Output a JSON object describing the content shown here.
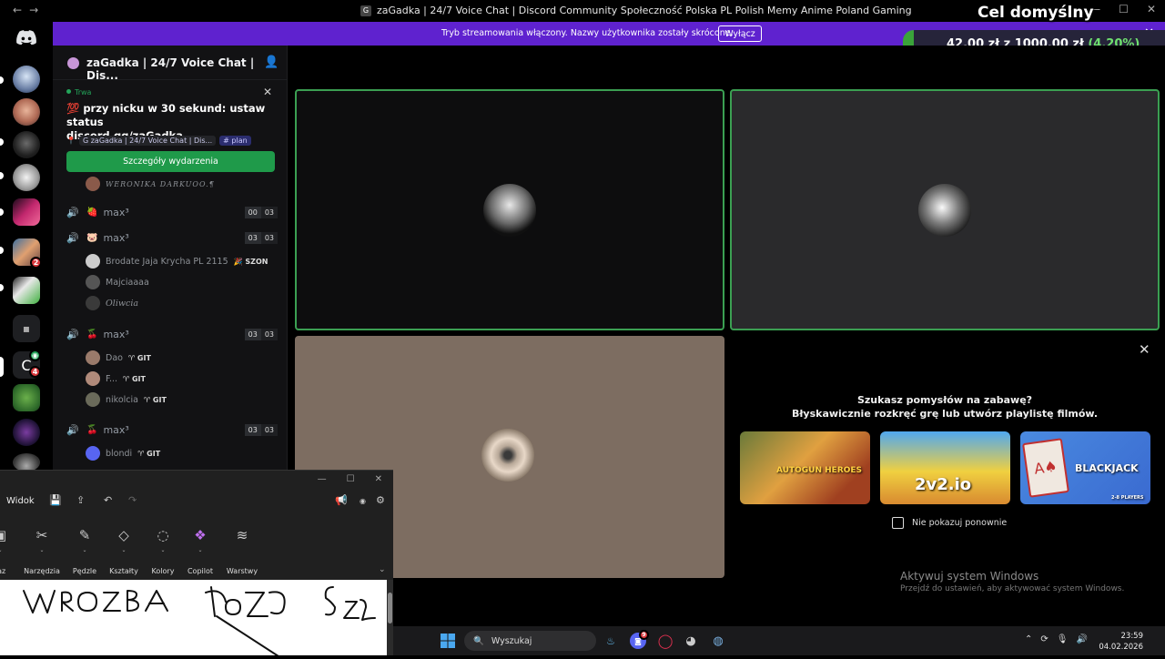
{
  "window": {
    "title": "zaGadka | 24/7 Voice Chat | Discord Community Społeczność Polska PL Polish Memy Anime Poland Gaming",
    "title_icon_letter": "G",
    "back": "←",
    "forward": "→"
  },
  "goal": {
    "heading": "Cel domyślny",
    "current": "42,00 zł",
    "separator": "z",
    "target": "1000,00 zł",
    "percent": "(4.20%)",
    "progress_fraction": 0.042
  },
  "stream_banner": {
    "message": "Tryb streamowania włączony. Nazwy użytkownika zostały skrócone.",
    "button": "Wyłącz",
    "close": "✕"
  },
  "guild_badges": {
    "b1": "2",
    "b2": "4"
  },
  "server": {
    "name": "zaGadka | 24/7 Voice Chat | Dis...",
    "invite_icon": "person-add-icon"
  },
  "event": {
    "status": "Trwa",
    "close": "✕",
    "title_line1": "💯 przy nicku w 30 sekund: ustaw status",
    "title_line2": "discord.gg/zaGadka",
    "location_server": "G zaGadka | 24/7 Voice Chat | Dis...",
    "location_channel": "# plan",
    "details_button": "Szczegóły wydarzenia"
  },
  "channels": [
    {
      "emoji": "🍓",
      "name": "max³",
      "count_a": "00",
      "count_b": "03",
      "active": false
    },
    {
      "emoji": "🐷",
      "name": "max³",
      "count_a": "03",
      "count_b": "03",
      "active": true
    },
    {
      "emoji": "🍒",
      "name": "max³",
      "count_a": "03",
      "count_b": "03",
      "active": true
    },
    {
      "emoji": "🍒",
      "name": "max³",
      "count_a": "03",
      "count_b": "03",
      "active": true
    }
  ],
  "users": {
    "top_partial": "WERONIKA DARKUOO.¶",
    "c2": [
      {
        "name": "Brodate Jaja Krycha PL 2115",
        "tag": "🎉 SZON"
      },
      {
        "name": "Majciaaaa",
        "tag": ""
      },
      {
        "name": "Oliwcia",
        "tag": ""
      }
    ],
    "c3": [
      {
        "name": "Dao",
        "tag": "♈ GIT"
      },
      {
        "name": "F...",
        "tag": "♈ GIT"
      },
      {
        "name": "nikolcia",
        "tag": "♈ GIT"
      }
    ],
    "c4": [
      {
        "name": "blondi",
        "tag": "♈ GIT"
      }
    ]
  },
  "activity": {
    "question": "Szukasz pomysłów na zabawę?",
    "subtitle": "Błyskawicznie rozkręć grę lub utwórz playlistę filmów.",
    "games": [
      "AUTOGUN HEROES",
      "2v2.io",
      "BLACKJACK"
    ],
    "blackjack_sub": "2-8 PLAYERS",
    "checkbox_label": "Nie pokazuj ponownie",
    "close": "✕"
  },
  "watermark": {
    "line1": "Aktywuj system Windows",
    "line2": "Przejdź do ustawień, aby aktywować system Windows."
  },
  "paint": {
    "view_menu": "Widok",
    "tools": [
      {
        "label": "raz",
        "icon": "image-icon"
      },
      {
        "label": "Narzędzia",
        "icon": "tools-icon"
      },
      {
        "label": "Pędzle",
        "icon": "brush-icon"
      },
      {
        "label": "Kształty",
        "icon": "shapes-icon"
      },
      {
        "label": "Kolory",
        "icon": "palette-icon"
      },
      {
        "label": "Copilot",
        "icon": "copilot-icon"
      },
      {
        "label": "Warstwy",
        "icon": "layers-icon"
      }
    ],
    "handwriting": "WROZBA 10ZŁ 5ZŁ"
  },
  "taskbar": {
    "search_placeholder": "Wyszukaj",
    "time": "23:59",
    "date": "04.02.2026",
    "discord_badge": "9"
  },
  "colors": {
    "accent_purple": "#5f22cf",
    "speaking_green": "#3b9f52",
    "event_button": "#1f9a4a",
    "goal_green": "#6fe06f"
  }
}
